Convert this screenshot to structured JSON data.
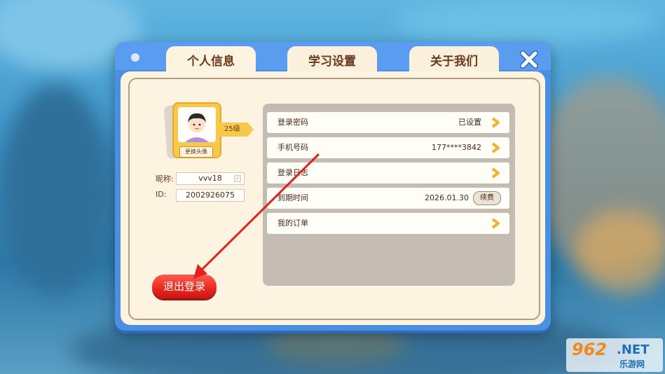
{
  "tabs": [
    {
      "label": "个人信息",
      "active": true
    },
    {
      "label": "学习设置",
      "active": false
    },
    {
      "label": "关于我们",
      "active": false
    }
  ],
  "profile": {
    "change_avatar_label": "更换头像",
    "level": "25级",
    "nickname_label": "昵称:",
    "nickname_value": "vvv18",
    "id_label": "ID:",
    "id_value": "2002926075"
  },
  "rows": [
    {
      "label": "登录密码",
      "value": "已设置"
    },
    {
      "label": "手机号码",
      "value": "177****3842"
    },
    {
      "label": "登录日志",
      "value": ""
    },
    {
      "label": "到期时间",
      "value": "2026.01.30",
      "button": "续费"
    },
    {
      "label": "我的订单",
      "value": ""
    }
  ],
  "logout_label": "退出登录",
  "watermark": {
    "num": "962",
    "net": ".NET",
    "cn": "乐游网"
  },
  "colors": {
    "accent_blue": "#4a8fe0",
    "tab_text": "#6b3a1e",
    "logout_red": "#e9281f",
    "chevron": "#f0b429"
  }
}
